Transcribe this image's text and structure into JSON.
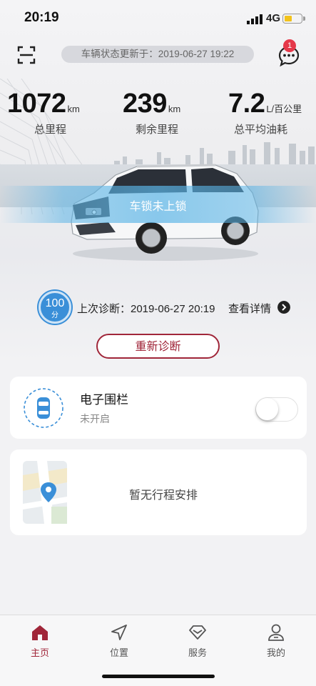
{
  "status_bar": {
    "time": "20:19",
    "network": "4G"
  },
  "header": {
    "update_text": "车辆状态更新于：2019-06-27 19:22",
    "message_badge": "1"
  },
  "stats": [
    {
      "value": "1072",
      "unit": "km",
      "label": "总里程"
    },
    {
      "value": "239",
      "unit": "km",
      "label": "剩余里程"
    },
    {
      "value": "7.2",
      "unit": "L/百公里",
      "label": "总平均油耗"
    }
  ],
  "lock_status": "车锁未上锁",
  "diagnosis": {
    "score": "100",
    "score_unit": "分",
    "last_text": "上次诊断：2019-06-27 20:19",
    "details_link": "查看详情",
    "rediagnose_button": "重新诊断"
  },
  "fence": {
    "title": "电子围栏",
    "subtitle": "未开启",
    "enabled": false
  },
  "trip": {
    "empty_text": "暂无行程安排"
  },
  "tabs": [
    {
      "label": "主页",
      "icon": "home-icon",
      "active": true
    },
    {
      "label": "位置",
      "icon": "navigation-icon",
      "active": false
    },
    {
      "label": "服务",
      "icon": "service-icon",
      "active": false
    },
    {
      "label": "我的",
      "icon": "profile-icon",
      "active": false
    }
  ],
  "colors": {
    "accent": "#a02639",
    "blue": "#3a8fd8",
    "badge": "#e5384a"
  }
}
